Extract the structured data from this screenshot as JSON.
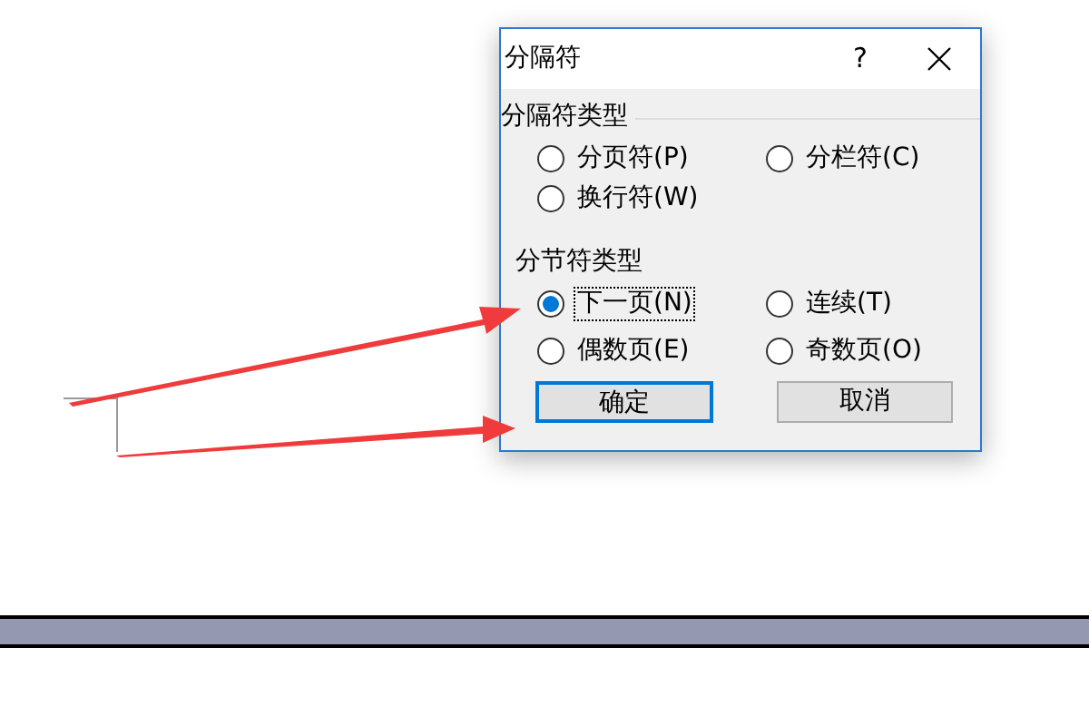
{
  "dialog": {
    "title": "分隔符",
    "help": "?",
    "groups": [
      {
        "label": "分隔符类型",
        "options": [
          {
            "label": "分页符(P)",
            "selected": false
          },
          {
            "label": "分栏符(C)",
            "selected": false
          },
          {
            "label": "换行符(W)",
            "selected": false
          }
        ]
      },
      {
        "label": "分节符类型",
        "options": [
          {
            "label": "下一页(N)",
            "selected": true
          },
          {
            "label": "连续(T)",
            "selected": false
          },
          {
            "label": "偶数页(E)",
            "selected": false
          },
          {
            "label": "奇数页(O)",
            "selected": false
          }
        ]
      }
    ],
    "buttons": [
      {
        "label": "确定",
        "default": true
      },
      {
        "label": "取消",
        "default": false
      }
    ]
  }
}
